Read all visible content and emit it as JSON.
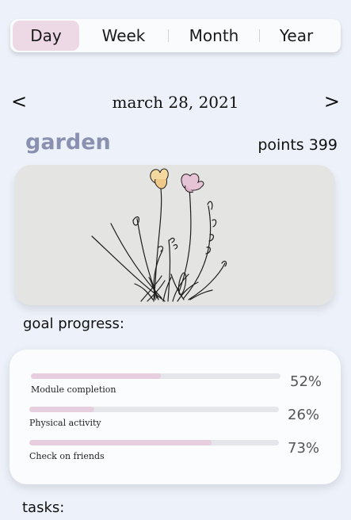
{
  "tabs": [
    {
      "label": "Day",
      "active": true
    },
    {
      "label": "Week",
      "active": false
    },
    {
      "label": "Month",
      "active": false
    },
    {
      "label": "Year",
      "active": false
    }
  ],
  "date_nav": {
    "prev": "<",
    "date": "march 28, 2021",
    "next": ">"
  },
  "garden": {
    "title": "garden",
    "points_label": "points 399"
  },
  "goal_progress": {
    "heading": "goal progress:",
    "items": [
      {
        "label": "Module completion",
        "percent_text": "52%",
        "value": 52
      },
      {
        "label": "Physical activity",
        "percent_text": "26%",
        "value": 26
      },
      {
        "label": "Check on friends",
        "percent_text": "73%",
        "value": 73
      }
    ]
  },
  "tasks": {
    "heading": "tasks:"
  },
  "colors": {
    "background": "#edf1f9",
    "active_tab": "#ecd9e5",
    "garden_title": "#8a90b0",
    "progress_fill": "#e8cfe0",
    "progress_track": "#e5e6ea",
    "flower_yellow": "#f3d9a0",
    "flower_pink": "#e7c3d6"
  }
}
